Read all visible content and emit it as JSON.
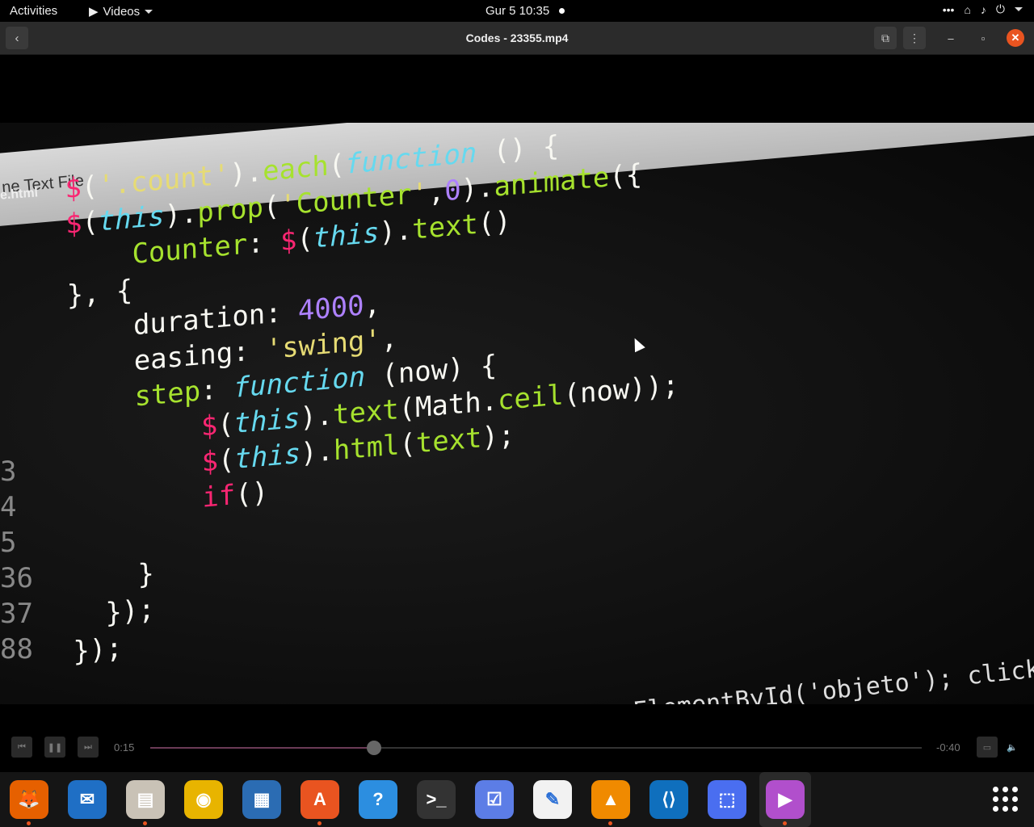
{
  "topbar": {
    "activities": "Activities",
    "app_name": "Videos",
    "clock": "Gur 5  10:35",
    "tray_more": "•••"
  },
  "window": {
    "title": "Codes - 23355.mp4"
  },
  "video": {
    "editor_menu": "ne Text    File",
    "file_tab": "e.html",
    "code_lines": [
      "$('.count').each(function () {",
      "$(this).prop('Counter',0).animate({",
      "    Counter: $(this).text()",
      "}, {",
      "    duration: 4000,",
      "    easing: 'swing',",
      "    step: function (now) {",
      "        $(this).text(Math.ceil(now));",
      "        $(this).html(text);",
      "        if()",
      "",
      "    }",
      "  });",
      "});"
    ],
    "gutter_numbers": [
      "3",
      "4",
      "5",
      "36",
      "37",
      "88"
    ],
    "bottom_snippet": "function(){        ElementById('objeto'); click = function(){"
  },
  "controls": {
    "elapsed": "0:15",
    "remaining": "-0:40",
    "progress_fraction": 0.29
  },
  "dock": {
    "apps": [
      {
        "name": "firefox",
        "running": true,
        "color": "#e66000"
      },
      {
        "name": "thunderbird",
        "running": false,
        "color": "#1f6fc5"
      },
      {
        "name": "files",
        "running": true,
        "color": "#c9c2b6"
      },
      {
        "name": "rhythmbox",
        "running": false,
        "color": "#e8b400"
      },
      {
        "name": "libreoffice-writer",
        "running": false,
        "color": "#2b6cb3"
      },
      {
        "name": "software",
        "running": true,
        "color": "#e95420"
      },
      {
        "name": "help",
        "running": false,
        "color": "#2c8ee0"
      },
      {
        "name": "terminal",
        "running": false,
        "color": "#333333"
      },
      {
        "name": "tasks",
        "running": false,
        "color": "#5c7de6"
      },
      {
        "name": "text-editor",
        "running": false,
        "color": "#f2f2f2"
      },
      {
        "name": "vlc",
        "running": true,
        "color": "#f08a00"
      },
      {
        "name": "vscode",
        "running": false,
        "color": "#0f6fbd"
      },
      {
        "name": "screenshot",
        "running": false,
        "color": "#4a6ef0"
      },
      {
        "name": "videos",
        "running": true,
        "color": "#b14fcc"
      }
    ]
  }
}
